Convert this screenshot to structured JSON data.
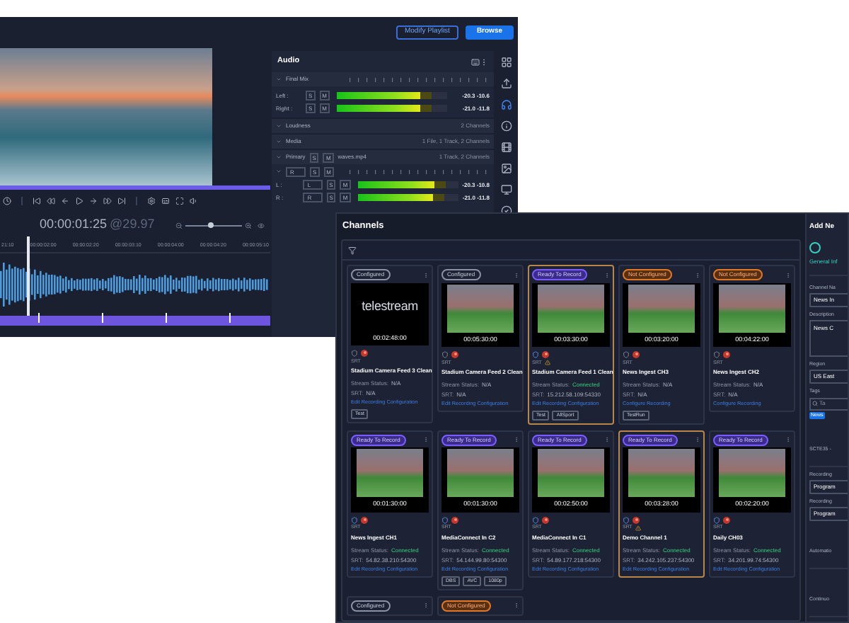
{
  "back_window": {
    "buttons": [
      {
        "label": "Modify Playlist",
        "kind": "outline"
      },
      {
        "label": "Browse",
        "kind": "primary"
      }
    ],
    "player": {
      "timecode": "00:00:01:25",
      "frame_rate": "@29.97",
      "zoom": {
        "level": 0.45
      },
      "ruler": [
        "21:10",
        "00:00:02:00",
        "00:00:02:20",
        "00:00:03:10",
        "00:00:04:00",
        "00:00:04:20",
        "00:00:05:10"
      ]
    },
    "audio": {
      "title": "Audio",
      "final_mix": {
        "label": "Final Mix",
        "channels": [
          {
            "name": "Left :",
            "solo": "S",
            "mute": "M",
            "level": 0.76,
            "reading": "-20.3 -10.6"
          },
          {
            "name": "Right :",
            "solo": "S",
            "mute": "M",
            "level": 0.75,
            "reading": "-21.0 -11.8"
          }
        ]
      },
      "sections": [
        {
          "label": "Loudness",
          "info": "2 Channels"
        },
        {
          "label": "Media",
          "info": "1 File, 1 Track, 2 Channels"
        }
      ],
      "primary": {
        "label": "Primary",
        "solo": "S",
        "mute": "M",
        "file": "waves.mp4",
        "info": "1 Track, 2 Channels",
        "select": "R",
        "solo2": "S",
        "mute2": "M",
        "channels": [
          {
            "name": "L :",
            "select": "L",
            "solo": "S",
            "mute": "M",
            "level": 0.76,
            "reading": "-20.3 -10.8"
          },
          {
            "name": "R :",
            "select": "R",
            "solo": "S",
            "mute": "M",
            "level": 0.75,
            "reading": "-21.0 -11.8"
          }
        ]
      }
    },
    "sidebar": [
      {
        "kind": "grid",
        "selected": false
      },
      {
        "kind": "upload",
        "selected": false
      },
      {
        "kind": "headphones",
        "selected": true
      },
      {
        "kind": "info",
        "selected": false
      },
      {
        "kind": "film",
        "selected": false
      },
      {
        "kind": "image",
        "selected": false
      },
      {
        "kind": "monitor",
        "selected": false
      },
      {
        "kind": "check",
        "selected": false
      }
    ]
  },
  "channels_window": {
    "title": "Channels",
    "rows": [
      [
        {
          "status": "Configured",
          "kind": "configured",
          "selected": false,
          "logo_text": "telestream",
          "time": "00:02:48:00",
          "protocol": "SRT",
          "warning": false,
          "name": "Stadium Camera Feed 3 Clean",
          "stream_label": "Stream Status:",
          "stream_value": "N/A",
          "stream_ok": false,
          "srt_label": "SRT:",
          "srt_value": "N/A",
          "link": "Edit Recording Configuration",
          "tags": [
            "Test"
          ]
        },
        {
          "status": "Configured",
          "kind": "configured",
          "selected": false,
          "time": "00:05:30:00",
          "protocol": "SRT",
          "warning": false,
          "name": "Stadium Camera Feed 2 Clean",
          "stream_label": "Stream Status:",
          "stream_value": "N/A",
          "stream_ok": false,
          "srt_label": "SRT:",
          "srt_value": "N/A",
          "link": "Edit Recording Configuration"
        },
        {
          "status": "Ready To Record",
          "kind": "ready",
          "selected": true,
          "time": "00:03:30:00",
          "protocol": "SRT",
          "warning": true,
          "name": "Stadium Camera Feed 1 Clean",
          "stream_label": "Stream Status:",
          "stream_value": "Connected",
          "stream_ok": true,
          "srt_label": "SRT:",
          "srt_value": "15.212.58.109:54330",
          "link": "Edit Recording Configuration",
          "tags": [
            "Test",
            "AllSport"
          ]
        },
        {
          "status": "Not Configured",
          "kind": "not_configured",
          "selected": false,
          "time": "00:03:20:00",
          "protocol": "SRT",
          "warning": false,
          "name": "News Ingest CH3",
          "stream_label": "Stream Status:",
          "stream_value": "N/A",
          "stream_ok": false,
          "srt_label": "SRT:",
          "srt_value": "N/A",
          "link": "Configure Recording",
          "tags": [
            "TestRun"
          ]
        },
        {
          "status": "Not Configured",
          "kind": "not_configured",
          "selected": false,
          "time": "00:04:22:00",
          "protocol": "SRT",
          "warning": false,
          "name": "News Ingest CH2",
          "stream_label": "Stream Status:",
          "stream_value": "N/A",
          "stream_ok": false,
          "srt_label": "SRT:",
          "srt_value": "N/A",
          "link": "Configure Recording"
        }
      ],
      [
        {
          "status": "Ready To Record",
          "kind": "ready",
          "selected": false,
          "time": "00:01:30:00",
          "protocol": "SRT",
          "warning": false,
          "name": "News Ingest CH1",
          "stream_label": "Stream Status:",
          "stream_value": "Connected",
          "stream_ok": true,
          "srt_label": "SRT:",
          "srt_value": "54.82.38.210:54300",
          "link": "Edit Recording Configuration"
        },
        {
          "status": "Ready To Record",
          "kind": "ready",
          "selected": false,
          "time": "00:01:30:00",
          "protocol": "SRT",
          "warning": false,
          "name": "MediaConnect In C2",
          "stream_label": "Stream Status:",
          "stream_value": "Connected",
          "stream_ok": true,
          "srt_label": "SRT:",
          "srt_value": "54.144.99.80:54300",
          "link": "Edit Recording Configuration",
          "tags": [
            "DBS",
            "AVC",
            "1080p"
          ]
        },
        {
          "status": "Ready To Record",
          "kind": "ready",
          "selected": false,
          "time": "00:02:50:00",
          "protocol": "SRT",
          "warning": false,
          "name": "MediaConnect In C1",
          "stream_label": "Stream Status:",
          "stream_value": "Connected",
          "stream_ok": true,
          "srt_label": "SRT:",
          "srt_value": "54.89.177.218:54300",
          "link": "Edit Recording Configuration"
        },
        {
          "status": "Ready To Record",
          "kind": "ready",
          "selected": true,
          "time": "00:03:28:00",
          "protocol": "SRT",
          "warning": true,
          "name": "Demo Channel 1",
          "stream_label": "Stream Status:",
          "stream_value": "Connected",
          "stream_ok": true,
          "srt_label": "SRT:",
          "srt_value": "34.242.105.237:54300",
          "link": "Edit Recording Configuration"
        },
        {
          "status": "Ready To Record",
          "kind": "ready",
          "selected": false,
          "time": "00:02:20:00",
          "protocol": "SRT",
          "warning": false,
          "name": "Daily CH03",
          "stream_label": "Stream Status:",
          "stream_value": "Connected",
          "stream_ok": true,
          "srt_label": "SRT:",
          "srt_value": "34.201.99.74:54300",
          "link": "Edit Recording Configuration"
        }
      ],
      [
        {
          "status": "Configured",
          "kind": "configured",
          "selected": false
        },
        {
          "status": "Not Configured",
          "kind": "not_configured",
          "selected": false
        }
      ]
    ],
    "panel": {
      "title": "Add Ne",
      "step": "General Inf",
      "fields": [
        {
          "kind": "input",
          "label": "Channel Na",
          "value": "News In"
        },
        {
          "kind": "textarea",
          "label": "Description",
          "value": "News C"
        },
        {
          "kind": "select",
          "label": "Region",
          "value": "US East"
        },
        {
          "kind": "search",
          "label": "Tags",
          "placeholder": "Ta",
          "chip": "News"
        },
        {
          "kind": "label",
          "label": "SCTE35 -"
        },
        {
          "kind": "select",
          "label": "Recording",
          "value": "Program"
        },
        {
          "kind": "select",
          "label": "Recording",
          "value": "Program"
        },
        {
          "kind": "label",
          "label": "Automatio"
        },
        {
          "kind": "label",
          "label": "Continuo"
        }
      ]
    }
  }
}
